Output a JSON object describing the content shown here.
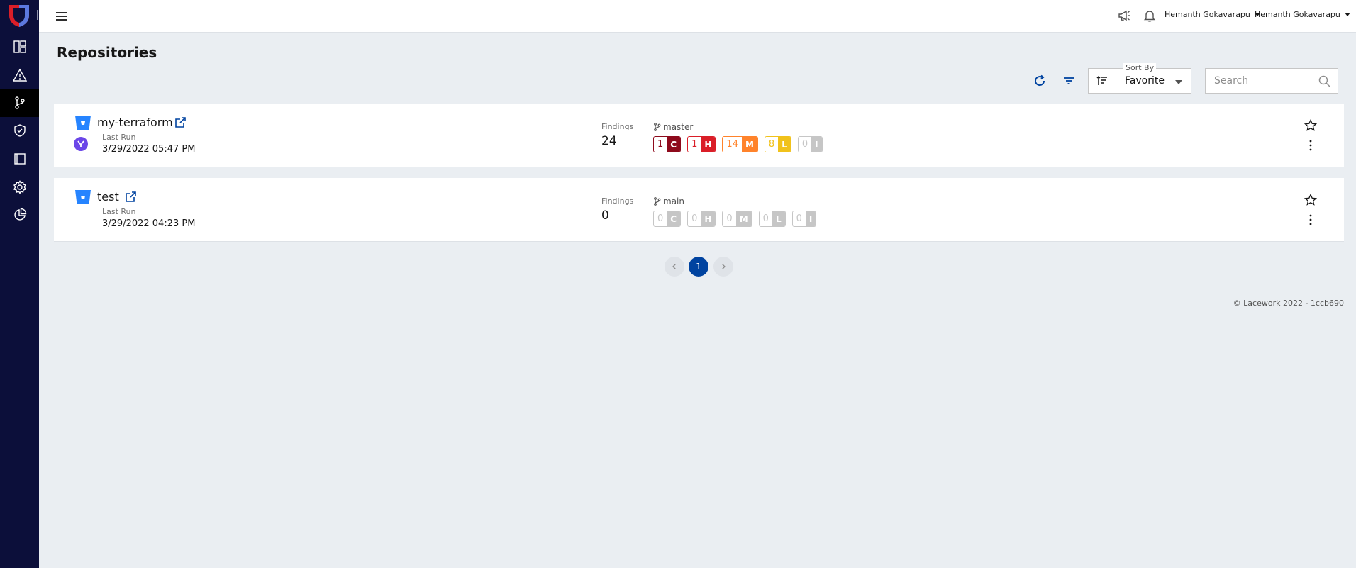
{
  "header": {
    "user_menu_1": "Hemanth Gokavarapu",
    "user_menu_2": "Hemanth Gokavarapu"
  },
  "page": {
    "title": "Repositories"
  },
  "toolbar": {
    "sort_by_label": "Sort By",
    "sort_by_value": "Favorite",
    "search_placeholder": "Search"
  },
  "repositories": [
    {
      "name": "my-terraform",
      "last_run_label": "Last Run",
      "last_run": "3/29/2022 05:47 PM",
      "findings_label": "Findings",
      "findings": "24",
      "branch": "master",
      "severities": [
        {
          "count": "1",
          "level": "C"
        },
        {
          "count": "1",
          "level": "H"
        },
        {
          "count": "14",
          "level": "M"
        },
        {
          "count": "8",
          "level": "L"
        },
        {
          "count": "0",
          "level": "I"
        }
      ]
    },
    {
      "name": "test",
      "last_run_label": "Last Run",
      "last_run": "3/29/2022 04:23 PM",
      "findings_label": "Findings",
      "findings": "0",
      "branch": "main",
      "severities": [
        {
          "count": "0",
          "level": "C"
        },
        {
          "count": "0",
          "level": "H"
        },
        {
          "count": "0",
          "level": "M"
        },
        {
          "count": "0",
          "level": "L"
        },
        {
          "count": "0",
          "level": "I"
        }
      ]
    }
  ],
  "pagination": {
    "current_page": "1"
  },
  "footer": {
    "text": "© Lacework 2022 - 1ccb690"
  },
  "colors": {
    "sidebar": "#0c0f3a",
    "critical": "#8e0a1c",
    "high": "#da1e28",
    "medium": "#ff832b",
    "low": "#f1c21b",
    "info": "#c6c6c6",
    "inactive": "#c6c6c6",
    "accent": "#0043a0"
  }
}
